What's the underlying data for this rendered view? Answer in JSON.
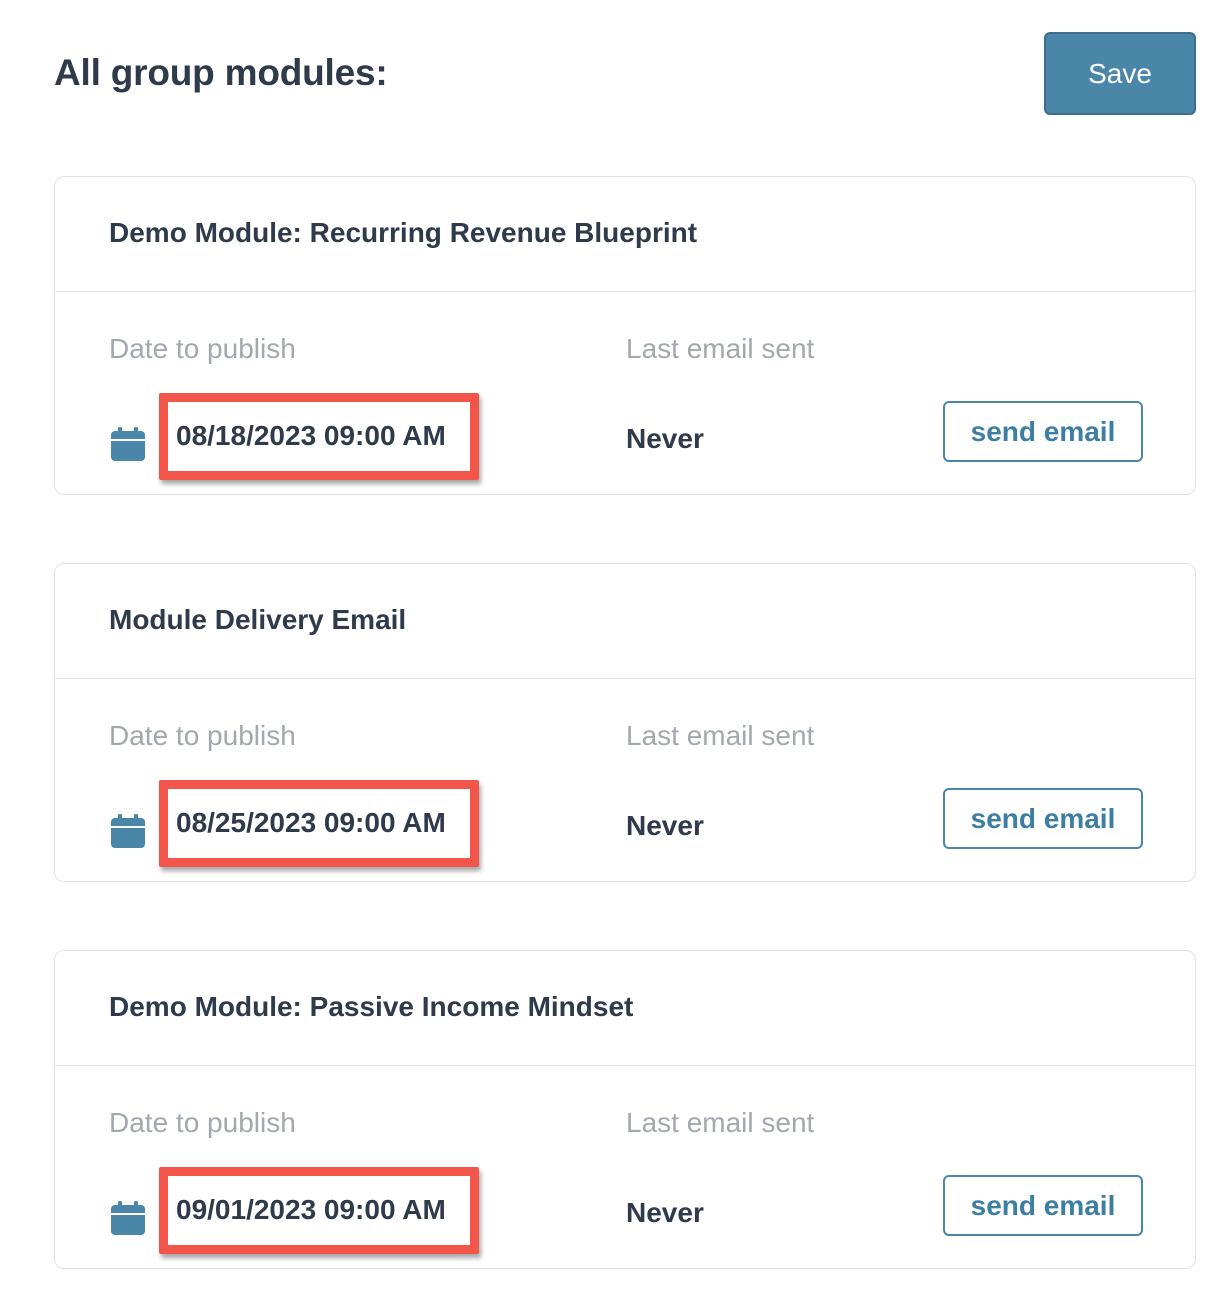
{
  "header": {
    "title": "All group modules:",
    "save_label": "Save"
  },
  "colors": {
    "accent": "#4a86a8",
    "highlight": "#f2564a",
    "text": "#2f3a4a",
    "muted": "#a3a8b0"
  },
  "modules": [
    {
      "title": "Demo Module: Recurring Revenue Blueprint",
      "publish_label": "Date to publish",
      "publish_date": "08/18/2023 09:00 AM",
      "last_sent_label": "Last email sent",
      "last_sent_value": "Never",
      "send_label": "send email",
      "icon": "calendar-icon"
    },
    {
      "title": "Module Delivery Email",
      "publish_label": "Date to publish",
      "publish_date": "08/25/2023 09:00 AM",
      "last_sent_label": "Last email sent",
      "last_sent_value": "Never",
      "send_label": "send email",
      "icon": "calendar-icon"
    },
    {
      "title": "Demo Module: Passive Income Mindset",
      "publish_label": "Date to publish",
      "publish_date": "09/01/2023 09:00 AM",
      "last_sent_label": "Last email sent",
      "last_sent_value": "Never",
      "send_label": "send email",
      "icon": "calendar-icon"
    }
  ]
}
